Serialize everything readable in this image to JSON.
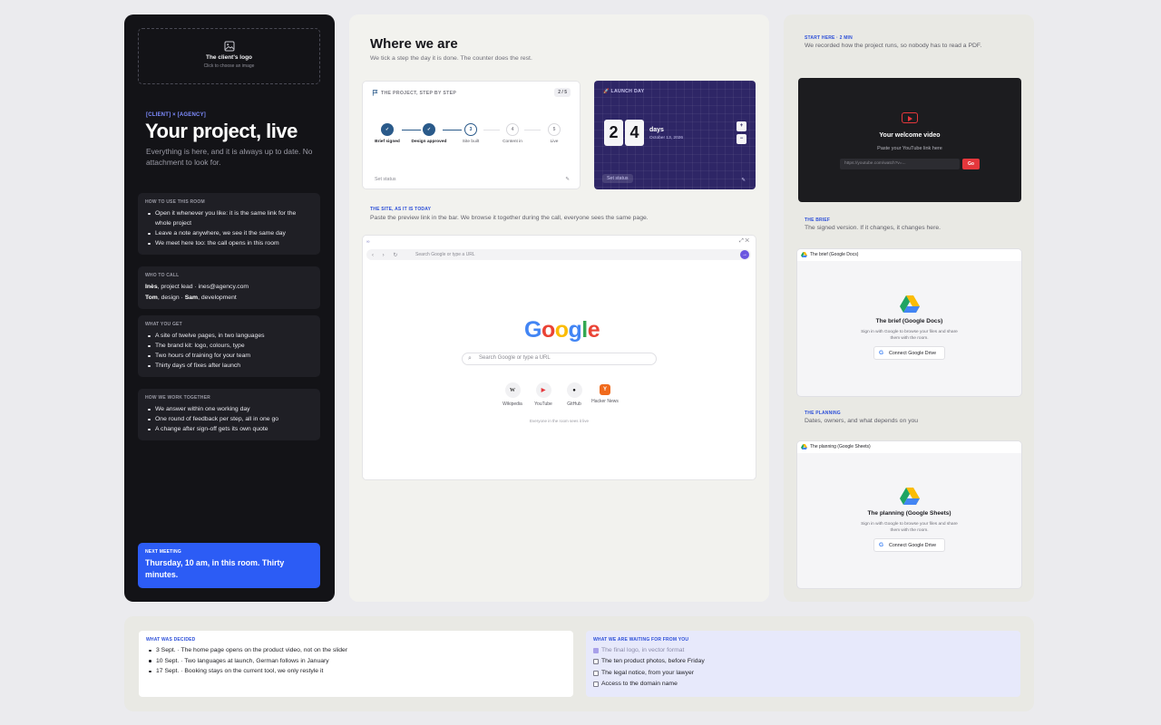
{
  "left": {
    "logo_title": "The client's logo",
    "logo_hint": "Click to choose an image",
    "tagline": "[CLIENT] × [AGENCY]",
    "title": "Your project, live",
    "subtitle": "Everything is here, and it is always up to date. No attachment to look for.",
    "how_to": {
      "head": "HOW TO USE THIS ROOM",
      "items": [
        "Open it whenever you like: it is the same link for the whole project",
        "Leave a note anywhere, we see it the same day",
        "We meet here too: the call opens in this room"
      ]
    },
    "who": {
      "head": "WHO TO CALL",
      "p1_name": "Inès",
      "p1_rest": ", project lead · ines@agency.com",
      "p2_name": "Tom",
      "p2_mid": ", design · ",
      "p3_name": "Sam",
      "p3_rest": ", development"
    },
    "get": {
      "head": "WHAT YOU GET",
      "items": [
        "A site of twelve pages, in two languages",
        "The brand kit: logo, colours, type",
        "Two hours of training for your team",
        "Thirty days of fixes after launch"
      ]
    },
    "together": {
      "head": "HOW WE WORK TOGETHER",
      "items": [
        "We answer within one working day",
        "One round of feedback per step, all in one go",
        "A change after sign-off gets its own quote"
      ]
    },
    "meeting": {
      "head": "NEXT MEETING",
      "text": "Thursday, 10 am, in this room. Thirty minutes."
    }
  },
  "mid": {
    "title": "Where we are",
    "subtitle": "We tick a step the day it is done. The counter does the rest.",
    "steps": {
      "head": "THE PROJECT, STEP BY STEP",
      "count": "2 / 5",
      "items": [
        {
          "num": "✓",
          "label": "Brief signed"
        },
        {
          "num": "✓",
          "label": "Design approved"
        },
        {
          "num": "3",
          "label": "Site built"
        },
        {
          "num": "4",
          "label": "Content in"
        },
        {
          "num": "5",
          "label": "Live"
        }
      ],
      "status": "Set status",
      "edit": "✎"
    },
    "launch": {
      "head": "LAUNCH DAY",
      "d1": "2",
      "d2": "4",
      "days": "days",
      "date": "October 13, 2026",
      "up": "+",
      "down": "−",
      "status": "Set status",
      "edit": "✎"
    },
    "site": {
      "head": "THE SITE, AS IT IS TODAY",
      "sub": "Paste the preview link in the bar. We browse it together during the call, everyone sees the same page.",
      "tab": "∞",
      "ctl": "⤢  ✕",
      "navs": "‹ › ↻",
      "url": "Search Google or type a URL",
      "go": "→",
      "search_placeholder": "Search Google or type a URL",
      "shortcuts": [
        {
          "icon": "W",
          "label": "Wikipedia"
        },
        {
          "icon": "▶",
          "label": "YouTube"
        },
        {
          "icon": "●",
          "label": "GitHub"
        },
        {
          "icon": "Y",
          "label": "Hacker News"
        }
      ],
      "footer": "Everyone in the room sees it live"
    }
  },
  "right": {
    "start_head": "START HERE · 2 MIN",
    "start_sub": "We recorded how the project runs, so nobody has to read a PDF.",
    "video": {
      "title": "Your welcome video",
      "sub": "Paste your YouTube link here",
      "placeholder": "https://youtube.com/watch?v=...",
      "go": "Go"
    },
    "brief_head": "THE BRIEF",
    "brief_sub": "The signed version. If it changes, it changes here.",
    "brief_card": {
      "top": "The brief (Google Docs)",
      "title": "The brief (Google Docs)",
      "desc": "Sign in with Google to browse your files and share them with the room.",
      "btn": "Connect Google Drive"
    },
    "plan_head": "THE PLANNING",
    "plan_sub": "Dates, owners, and what depends on you",
    "plan_card": {
      "top": "The planning (Google Sheets)",
      "title": "The planning (Google Sheets)",
      "desc": "Sign in with Google to browse your files and share them with the room.",
      "btn": "Connect Google Drive"
    }
  },
  "bottom": {
    "decided": {
      "head": "WHAT WAS DECIDED",
      "items": [
        "3 Sept. · The home page opens on the product video, not on the slider",
        "10 Sept. · Two languages at launch, German follows in January",
        "17 Sept. · Booking stays on the current tool, we only restyle it"
      ]
    },
    "waiting": {
      "head": "WHAT WE ARE WAITING FOR FROM YOU",
      "items": [
        "The final logo, in vector format",
        "The ten product photos, before Friday",
        "The legal notice, from your lawyer",
        "Access to the domain name"
      ]
    }
  },
  "colors": {
    "accent": "#2c5cf5",
    "dark": "#131317",
    "launch": "#2e2666",
    "youtube": "#e5373c"
  }
}
